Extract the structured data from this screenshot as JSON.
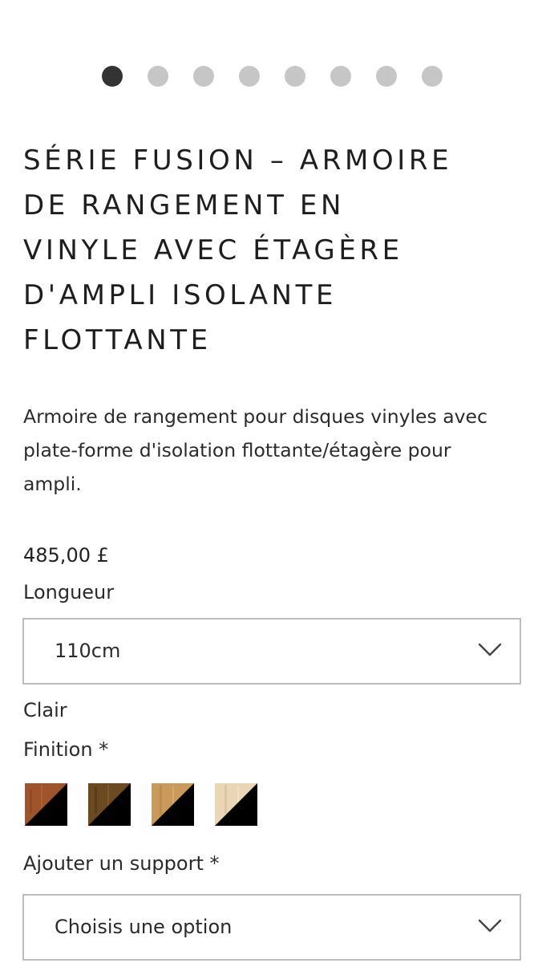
{
  "carousel": {
    "slide_count": 8,
    "active_index": 0
  },
  "product": {
    "title_lines": [
      "SÉRIE FUSION – ARMOIRE",
      "DE RANGEMENT EN",
      "VINYLE AVEC ÉTAGÈRE",
      "D'AMPLI ISOLANTE",
      "FLOTTANTE"
    ],
    "description_lines": [
      "Armoire de rangement pour disques vinyles avec",
      "plate-forme d'isolation flottante/étagère pour",
      "ampli."
    ],
    "price": "485,00 £"
  },
  "options": {
    "length": {
      "label": "Longueur",
      "selected": "110cm"
    },
    "selected_finish_name": "Clair",
    "finish": {
      "label": "Finition *",
      "swatches": [
        {
          "name": "walnut",
          "color": "#a0542c"
        },
        {
          "name": "dark-oak",
          "color": "#6b4a22"
        },
        {
          "name": "oak",
          "color": "#c99a5c"
        },
        {
          "name": "light",
          "color": "#e8d6b6"
        }
      ]
    },
    "support": {
      "label": "Ajouter un support *",
      "selected": "Choisis une option"
    }
  },
  "colors": {
    "dot_active": "#333333",
    "dot_inactive": "#c6c6c6",
    "border": "#bdbdbd",
    "text": "#222222"
  }
}
